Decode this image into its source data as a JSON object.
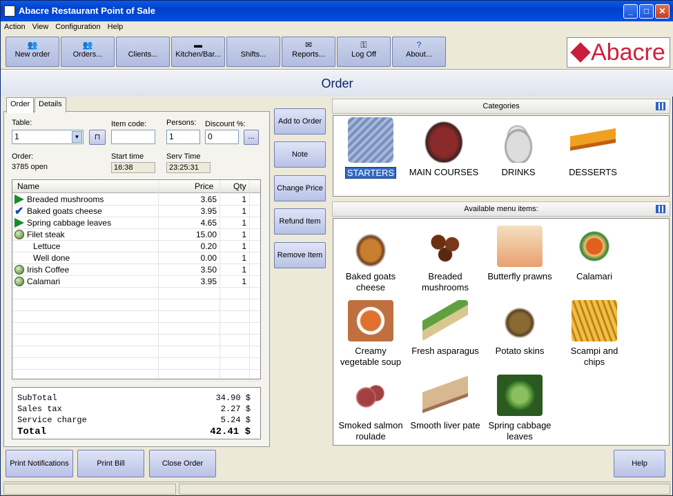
{
  "window": {
    "title": "Abacre Restaurant Point of Sale"
  },
  "menu": [
    "Action",
    "View",
    "Configuration",
    "Help"
  ],
  "toolbar": [
    {
      "label": "New order",
      "icon": "people-add-icon"
    },
    {
      "label": "Orders...",
      "icon": "people-icon"
    },
    {
      "label": "Clients...",
      "icon": ""
    },
    {
      "label": "Kitchen/Bar...",
      "icon": "kitchen-icon"
    },
    {
      "label": "Shifts...",
      "icon": ""
    },
    {
      "label": "Reports...",
      "icon": "reports-icon"
    },
    {
      "label": "Log Off",
      "icon": "key-icon"
    },
    {
      "label": "About...",
      "icon": "help-icon"
    }
  ],
  "logo": {
    "text": "Abacre"
  },
  "page_title": "Order",
  "tabs": [
    "Order",
    "Details"
  ],
  "form": {
    "table_label": "Table:",
    "table_value": "1",
    "item_code_label": "Item code:",
    "item_code_value": "",
    "persons_label": "Persons:",
    "persons_value": "1",
    "discount_label": "Discount %:",
    "discount_value": "0",
    "discount_btn": "...",
    "order_label": "Order:",
    "order_value": "3785 open",
    "start_time_label": "Start time",
    "start_time_value": "16:38",
    "serv_time_label": "Serv Time",
    "serv_time_value": "23:25:31"
  },
  "grid": {
    "columns": [
      "Name",
      "Price",
      "Qty"
    ],
    "rows": [
      {
        "name": "Breaded mushrooms",
        "price": "3.65",
        "qty": "1",
        "marker": "play",
        "indent": false
      },
      {
        "name": "Baked goats cheese",
        "price": "3.95",
        "qty": "1",
        "marker": "check",
        "indent": false
      },
      {
        "name": "Spring cabbage leaves",
        "price": "4.65",
        "qty": "1",
        "marker": "play",
        "indent": false
      },
      {
        "name": "Filet steak",
        "price": "15.00",
        "qty": "1",
        "marker": "ball",
        "indent": false
      },
      {
        "name": "Lettuce",
        "price": "0.20",
        "qty": "1",
        "marker": "",
        "indent": true
      },
      {
        "name": "Well done",
        "price": "0.00",
        "qty": "1",
        "marker": "",
        "indent": true
      },
      {
        "name": "Irish Coffee",
        "price": "3.50",
        "qty": "1",
        "marker": "ball",
        "indent": false
      },
      {
        "name": "Calamari",
        "price": "3.95",
        "qty": "1",
        "marker": "ball",
        "indent": false
      }
    ]
  },
  "totals": {
    "subtotal_label": "SubTotal",
    "subtotal_value": "34.90 $",
    "tax_label": "Sales tax",
    "tax_value": "2.27 $",
    "service_label": "Service charge",
    "service_value": "5.24 $",
    "total_label": "Total",
    "total_value": "42.41 $"
  },
  "actions": [
    "Add to Order",
    "Note",
    "Change Price",
    "Refund Item",
    "Remove Item"
  ],
  "categories_title": "Categories",
  "categories": [
    {
      "name": "STARTERS",
      "selected": true
    },
    {
      "name": "MAIN COURSES",
      "selected": false
    },
    {
      "name": "DRINKS",
      "selected": false
    },
    {
      "name": "DESSERTS",
      "selected": false
    }
  ],
  "menu_items_title": "Available menu items:",
  "menu_items": [
    {
      "line1": "Baked goats",
      "line2": "cheese"
    },
    {
      "line1": "Breaded",
      "line2": "mushrooms"
    },
    {
      "line1": "Butterfly prawns",
      "line2": ""
    },
    {
      "line1": "Calamari",
      "line2": ""
    },
    {
      "line1": "Creamy",
      "line2": "vegetable soup"
    },
    {
      "line1": "Fresh asparagus",
      "line2": ""
    },
    {
      "line1": "Potato skins",
      "line2": ""
    },
    {
      "line1": "Scampi and",
      "line2": "chips"
    },
    {
      "line1": "Smoked salmon",
      "line2": "roulade"
    },
    {
      "line1": "Smooth liver pate",
      "line2": ""
    },
    {
      "line1": "Spring cabbage",
      "line2": "leaves"
    }
  ],
  "bottom": {
    "print_notifications": "Print Notifications",
    "print_bill": "Print Bill",
    "close_order": "Close Order",
    "help": "Help"
  }
}
